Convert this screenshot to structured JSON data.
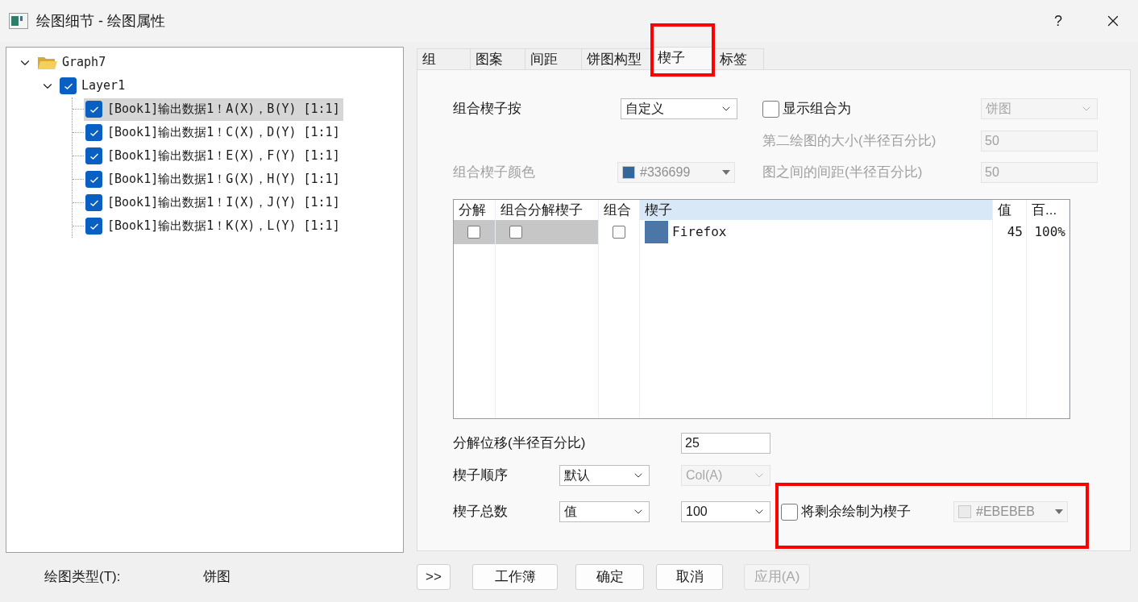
{
  "window": {
    "title": "绘图细节 - 绘图属性",
    "help": "?"
  },
  "tree": {
    "label": "Graph7",
    "expanded": true,
    "children": [
      {
        "label": "Layer1",
        "checked": true,
        "expanded": true,
        "children": [
          {
            "label": "[Book1]输出数据1！A(X)，B(Y) [1:1]",
            "checked": true,
            "selected": true
          },
          {
            "label": "[Book1]输出数据1！C(X)，D(Y) [1:1]",
            "checked": true,
            "selected": false
          },
          {
            "label": "[Book1]输出数据1！E(X)，F(Y) [1:1]",
            "checked": true,
            "selected": false
          },
          {
            "label": "[Book1]输出数据1！G(X)，H(Y) [1:1]",
            "checked": true,
            "selected": false
          },
          {
            "label": "[Book1]输出数据1！I(X)，J(Y) [1:1]",
            "checked": true,
            "selected": false
          },
          {
            "label": "[Book1]输出数据1！K(X)，L(Y) [1:1]",
            "checked": true,
            "selected": false
          }
        ]
      }
    ]
  },
  "tabs": [
    {
      "label": "组",
      "selected": false,
      "highlighted": false
    },
    {
      "label": "图案",
      "selected": false,
      "highlighted": false
    },
    {
      "label": "间距",
      "selected": false,
      "highlighted": false
    },
    {
      "label": "饼图构型",
      "selected": false,
      "highlighted": false
    },
    {
      "label": "楔子",
      "selected": true,
      "highlighted": true
    },
    {
      "label": "标签",
      "selected": false,
      "highlighted": false
    }
  ],
  "group_by": {
    "label": "组合楔子按",
    "value": "自定义",
    "disabled": false
  },
  "show_group_as": {
    "label": "显示组合为",
    "checked": false,
    "value": "饼图",
    "disabled": true
  },
  "second_plot_size": {
    "label": "第二绘图的大小(半径百分比)",
    "value": "50",
    "disabled": true
  },
  "group_color": {
    "label": "组合楔子颜色",
    "value": "#336699",
    "color": "#336699",
    "disabled": true
  },
  "plot_spacing": {
    "label": "图之间的间距(半径百分比)",
    "value": "50",
    "disabled": true
  },
  "table": {
    "columns": [
      {
        "label": "分解",
        "selected": false
      },
      {
        "label": "组合分解楔子",
        "selected": false
      },
      {
        "label": "组合",
        "selected": false
      },
      {
        "label": "楔子",
        "selected": true
      },
      {
        "label": "值",
        "selected": false
      },
      {
        "label": "百...",
        "selected": false
      }
    ],
    "rows": [
      {
        "cells": [
          {
            "kind": "checkbox",
            "checked": false,
            "selected": true
          },
          {
            "kind": "checkbox",
            "checked": false,
            "selected": true
          },
          {
            "kind": "checkbox",
            "checked": false,
            "selected": false
          },
          {
            "kind": "swatch",
            "text": "Firefox",
            "color": "#4a76a8",
            "selected": false
          },
          {
            "kind": "text",
            "text": "45",
            "selected": false
          },
          {
            "kind": "text",
            "text": "100%",
            "selected": false
          }
        ]
      }
    ]
  },
  "explode_offset": {
    "label": "分解位移(半径百分比)",
    "value": "25"
  },
  "wedge_order": {
    "label": "楔子顺序",
    "value": "默认",
    "disabled": false,
    "column": "Col(A)",
    "column_disabled": true
  },
  "wedge_total": {
    "label": "楔子总数",
    "value": "值",
    "disabled": false,
    "amount": "100",
    "amount_disabled": false
  },
  "remainder": {
    "label": "将剩余绘制为楔子",
    "checked": false,
    "value": "#EBEBEB",
    "color": "#ebebeb",
    "disabled": true,
    "highlighted": true
  },
  "plot_type": {
    "label": "绘图类型(T):",
    "value": "饼图"
  },
  "buttons": [
    {
      "label": ">>",
      "disabled": false
    },
    {
      "label": "工作簿",
      "disabled": false
    },
    {
      "label": "确定",
      "disabled": false
    },
    {
      "label": "取消",
      "disabled": false
    },
    {
      "label": "应用(A)",
      "disabled": true
    }
  ]
}
